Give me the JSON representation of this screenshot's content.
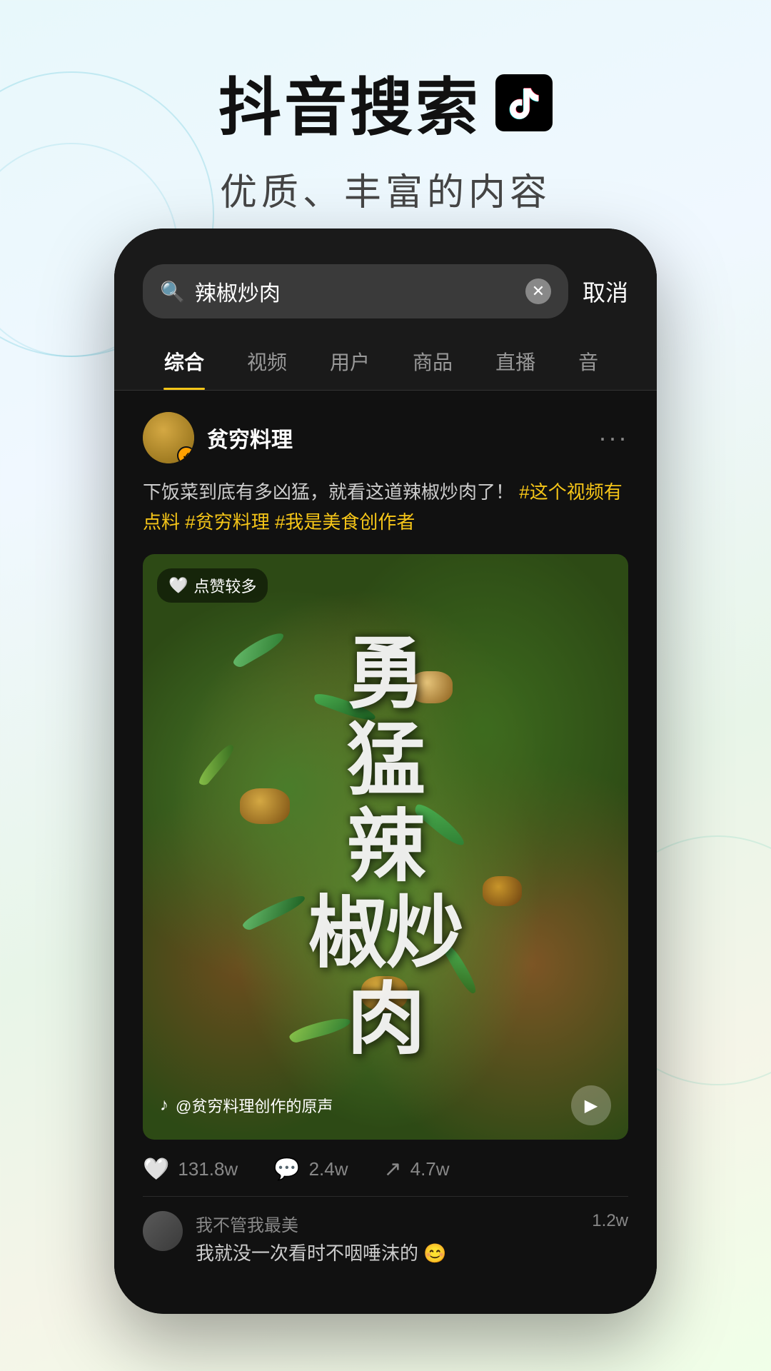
{
  "background": {
    "gradient": "light blue-green to light yellow-green"
  },
  "header": {
    "main_title": "抖音搜索",
    "subtitle": "优质、丰富的内容",
    "logo_alt": "TikTok logo"
  },
  "phone": {
    "search_bar": {
      "query": "辣椒炒肉",
      "cancel_label": "取消",
      "placeholder": "搜索"
    },
    "tabs": [
      {
        "label": "综合",
        "active": true
      },
      {
        "label": "视频",
        "active": false
      },
      {
        "label": "用户",
        "active": false
      },
      {
        "label": "商品",
        "active": false
      },
      {
        "label": "直播",
        "active": false
      },
      {
        "label": "音",
        "active": false
      }
    ],
    "post": {
      "username": "贫穷料理",
      "verified": true,
      "more_icon": "···",
      "description": "下饭菜到底有多凶猛，就看这道辣椒炒肉了！",
      "hashtags": [
        "#这个视频有点料",
        "#贫穷料理",
        "#我是美食创作者"
      ],
      "video": {
        "like_badge": "点赞较多",
        "overlay_text": "勇猛辣椒炒肉",
        "overlay_text_lines": [
          "勇",
          "猛",
          "辣",
          "椒炒",
          "肉"
        ],
        "sound_info": "@贫穷料理创作的原声",
        "play_icon": "▶"
      },
      "stats": {
        "likes": "131.8w",
        "comments": "2.4w",
        "shares": "4.7w"
      },
      "comments": [
        {
          "username": "我不管我最美",
          "text": "我就没一次看时不咽唾沫的 😊",
          "count": "1.2w"
        }
      ]
    }
  }
}
